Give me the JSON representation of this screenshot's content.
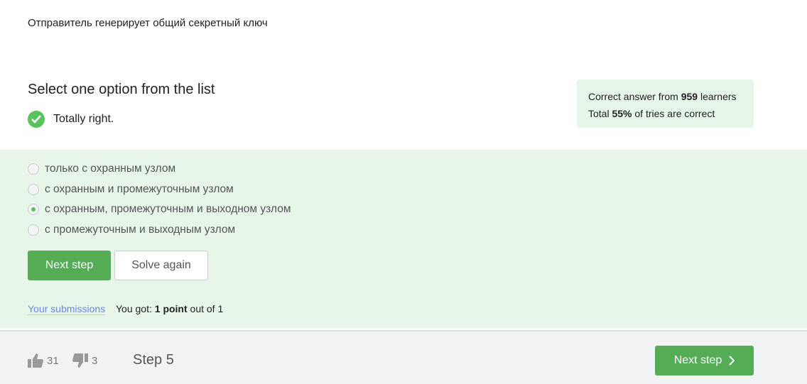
{
  "question_text": "Отправитель генерирует общий секретный ключ",
  "section_title": "Select one option from the list",
  "feedback": "Totally right.",
  "stats": {
    "line1_pre": "Correct answer from ",
    "learners": "959",
    "line1_post": " learners",
    "line2_pre": "Total ",
    "percent": "55%",
    "line2_post": " of tries are correct"
  },
  "options": [
    {
      "label": "только с охранным узлом",
      "selected": false
    },
    {
      "label": "с охранным и промежуточным узлом",
      "selected": false
    },
    {
      "label": "с охранным, промежуточным и выходном узлом",
      "selected": true
    },
    {
      "label": "с промежуточным и выходным узлом",
      "selected": false
    }
  ],
  "buttons": {
    "next": "Next step",
    "solve_again": "Solve again"
  },
  "submissions_link": "Your submissions",
  "score": {
    "pre": "You got: ",
    "points": "1 point",
    "post": " out of 1"
  },
  "footer": {
    "likes": "31",
    "dislikes": "3",
    "step": "Step 5",
    "next": "Next step"
  },
  "colors": {
    "accent": "#54ad55",
    "success_bg": "#e8f6ea"
  }
}
